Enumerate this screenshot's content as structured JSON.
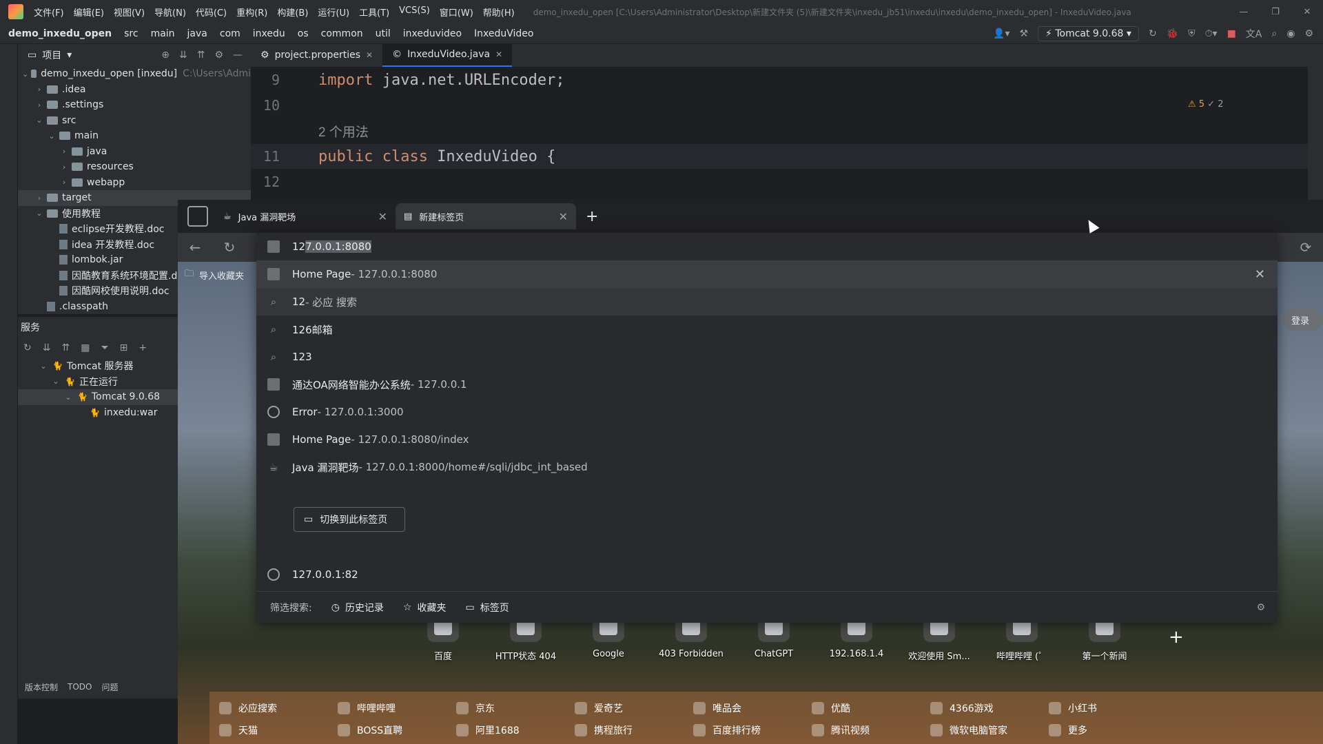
{
  "ide": {
    "menu": [
      "文件(F)",
      "编辑(E)",
      "视图(V)",
      "导航(N)",
      "代码(C)",
      "重构(R)",
      "构建(B)",
      "运行(U)",
      "工具(T)",
      "VCS(S)",
      "窗口(W)",
      "帮助(H)"
    ],
    "window_title": "demo_inxedu_open [C:\\Users\\Administrator\\Desktop\\新建文件夹 (5)\\新建文件夹\\inxedu_jb51\\inxedu\\inxedu\\demo_inxedu_open] - InxeduVideo.java",
    "breadcrumbs": [
      "demo_inxedu_open",
      "src",
      "main",
      "java",
      "com",
      "inxedu",
      "os",
      "common",
      "util",
      "inxeduvideo",
      "InxeduVideo"
    ],
    "run_config": "Tomcat 9.0.68",
    "project_label": "项目",
    "tree": [
      {
        "label": "demo_inxedu_open [inxedu]",
        "hint": "C:\\Users\\Admi",
        "indent": 0,
        "arrow": "v",
        "kind": "folder"
      },
      {
        "label": ".idea",
        "indent": 1,
        "arrow": ">",
        "kind": "folder"
      },
      {
        "label": ".settings",
        "indent": 1,
        "arrow": ">",
        "kind": "folder"
      },
      {
        "label": "src",
        "indent": 1,
        "arrow": "v",
        "kind": "folder"
      },
      {
        "label": "main",
        "indent": 2,
        "arrow": "v",
        "kind": "folder"
      },
      {
        "label": "java",
        "indent": 3,
        "arrow": ">",
        "kind": "folder"
      },
      {
        "label": "resources",
        "indent": 3,
        "arrow": ">",
        "kind": "folder"
      },
      {
        "label": "webapp",
        "indent": 3,
        "arrow": ">",
        "kind": "folder"
      },
      {
        "label": "target",
        "indent": 1,
        "arrow": ">",
        "kind": "folder",
        "selected": true
      },
      {
        "label": "使用教程",
        "indent": 1,
        "arrow": "v",
        "kind": "folder"
      },
      {
        "label": "eclipse开发教程.doc",
        "indent": 2,
        "arrow": "",
        "kind": "doc"
      },
      {
        "label": "idea 开发教程.doc",
        "indent": 2,
        "arrow": "",
        "kind": "doc"
      },
      {
        "label": "lombok.jar",
        "indent": 2,
        "arrow": "",
        "kind": "doc"
      },
      {
        "label": "因酷教育系统环境配置.d",
        "indent": 2,
        "arrow": "",
        "kind": "doc"
      },
      {
        "label": "因酷网校使用说明.doc",
        "indent": 2,
        "arrow": "",
        "kind": "doc"
      },
      {
        "label": ".classpath",
        "indent": 1,
        "arrow": "",
        "kind": "doc"
      }
    ],
    "services_title": "服务",
    "services_tree": [
      {
        "label": "Tomcat 服务器",
        "indent": 0,
        "arrow": "v"
      },
      {
        "label": "正在运行",
        "indent": 1,
        "arrow": "v"
      },
      {
        "label": "Tomcat 9.0.68",
        "indent": 2,
        "arrow": "v",
        "selected": true
      },
      {
        "label": "inxedu:war",
        "indent": 3,
        "arrow": ""
      }
    ],
    "bottom_tabs": [
      "版本控制",
      "TODO",
      "问题"
    ],
    "editor_tabs": [
      {
        "label": "project.properties",
        "active": false
      },
      {
        "label": "InxeduVideo.java",
        "active": true
      }
    ],
    "inspections": {
      "warnings": "5",
      "weak": "2"
    },
    "code": [
      {
        "ln": "9",
        "tokens": [
          {
            "t": "import ",
            "c": "kw"
          },
          {
            "t": "java.net.URLEncoder;",
            "c": "id"
          }
        ]
      },
      {
        "ln": "10",
        "tokens": []
      },
      {
        "ln": "",
        "tokens": [
          {
            "t": "2 个用法",
            "c": "hint2"
          }
        ]
      },
      {
        "ln": "11",
        "tokens": [
          {
            "t": "public class ",
            "c": "kw"
          },
          {
            "t": "InxeduVideo ",
            "c": "cls"
          },
          {
            "t": "{",
            "c": "id"
          }
        ]
      },
      {
        "ln": "12",
        "tokens": []
      }
    ]
  },
  "browser": {
    "tabs": [
      {
        "label": "Java 漏洞靶场",
        "active": false
      },
      {
        "label": "新建标签页",
        "active": true
      }
    ],
    "import_bookmarks": "导入收藏夹",
    "omnibox": {
      "typed_prefix": "12",
      "autocomplete": "7.0.0.1:8080"
    },
    "suggestions": [
      {
        "kind": "page",
        "main": "Home Page",
        "sub": " - 127.0.0.1:8080",
        "state": "sel"
      },
      {
        "kind": "search",
        "main": "12",
        "sub": " - 必应 搜索",
        "state": "hover"
      },
      {
        "kind": "search",
        "main": "126邮箱",
        "sub": ""
      },
      {
        "kind": "search",
        "main": "123",
        "sub": ""
      },
      {
        "kind": "page",
        "main": "通达OA网络智能办公系统",
        "sub": " - 127.0.0.1"
      },
      {
        "kind": "globe",
        "main": "Error",
        "sub": " - 127.0.0.1:3000"
      },
      {
        "kind": "page",
        "main": "Home Page",
        "sub": " - 127.0.0.1:8080/index"
      },
      {
        "kind": "tab",
        "main": "Java 漏洞靶场",
        "sub": " - 127.0.0.1:8000/home#/sqli/jdbc_int_based"
      },
      {
        "kind": "globe",
        "main": "127.0.0.1:82",
        "sub": ""
      }
    ],
    "switch_tab": "切换到此标签页",
    "filter_label": "筛选搜索:",
    "filters": [
      "历史记录",
      "收藏夹",
      "标签页"
    ],
    "login": "登录",
    "quick_links": [
      "百度",
      "HTTP状态 404",
      "Google",
      "403 Forbidden",
      "ChatGPT",
      "192.168.1.4",
      "欢迎使用 Sm...",
      "哔哩哔哩 (゜",
      "第一个新闻"
    ],
    "shortcuts_row1": [
      "必应搜索",
      "哔哩哔哩",
      "京东",
      "爱奇艺",
      "唯品会",
      "优酷",
      "4366游戏",
      "小红书"
    ],
    "shortcuts_row2": [
      "天猫",
      "BOSS直聘",
      "阿里1688",
      "携程旅行",
      "百度排行榜",
      "腾讯视频",
      "微软电脑管家",
      "更多"
    ]
  }
}
